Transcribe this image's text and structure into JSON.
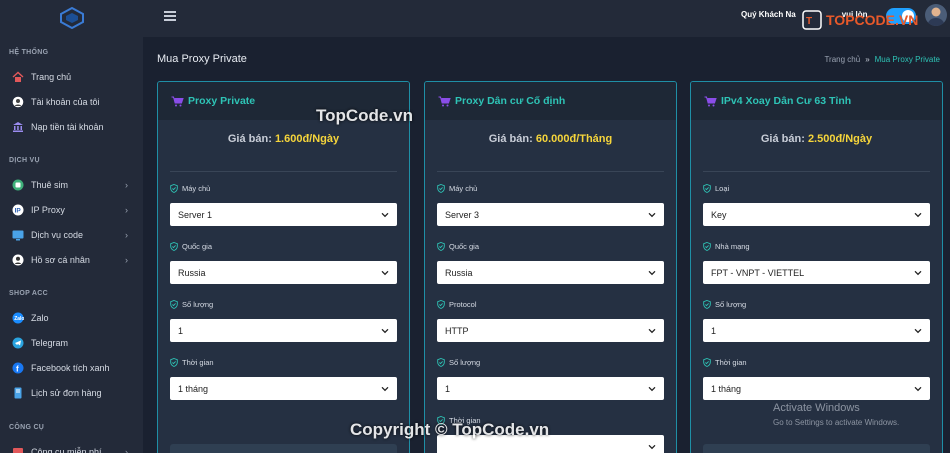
{
  "sidebar": {
    "sections": [
      {
        "title": "HỆ THỐNG",
        "items": [
          {
            "label": "Trang chủ",
            "icon": "home-icon",
            "chevron": false
          },
          {
            "label": "Tài khoản của tôi",
            "icon": "user-circle-icon",
            "chevron": false
          },
          {
            "label": "Nạp tiền tài khoản",
            "icon": "bank-icon",
            "chevron": false
          }
        ]
      },
      {
        "title": "DỊCH VỤ",
        "items": [
          {
            "label": "Thuê sim",
            "icon": "sim-icon",
            "chevron": true
          },
          {
            "label": "IP Proxy",
            "icon": "ip-icon",
            "chevron": true
          },
          {
            "label": "Dịch vụ code",
            "icon": "code-icon",
            "chevron": true
          },
          {
            "label": "Hồ sơ cá nhân",
            "icon": "profile-icon",
            "chevron": true
          }
        ]
      },
      {
        "title": "SHOP ACC",
        "items": [
          {
            "label": "Zalo",
            "icon": "zalo-icon",
            "chevron": false
          },
          {
            "label": "Telegram",
            "icon": "telegram-icon",
            "chevron": false
          },
          {
            "label": "Facebook tích xanh",
            "icon": "facebook-icon",
            "chevron": false
          },
          {
            "label": "Lịch sử đơn hàng",
            "icon": "history-icon",
            "chevron": false
          }
        ]
      },
      {
        "title": "CÔNG CỤ",
        "items": [
          {
            "label": "Công cụ miễn phí",
            "icon": "tool-icon",
            "chevron": true
          }
        ]
      }
    ]
  },
  "topbar": {
    "welcome": "Quý Khách Na",
    "welcome_tail": "vui lòn",
    "brand": "TOPCODE.VN"
  },
  "page": {
    "title": "Mua Proxy Private",
    "breadcrumb_home": "Trang chủ",
    "breadcrumb_sep": "»",
    "breadcrumb_current": "Mua Proxy Private"
  },
  "cards": [
    {
      "title": "Proxy Private",
      "price_label": "Giá bán:",
      "price_value": "1.600đ/Ngày",
      "fields": [
        {
          "label": "Máy chủ",
          "value": "Server 1"
        },
        {
          "label": "Quốc gia",
          "value": "Russia"
        },
        {
          "label": "Số lượng",
          "value": "1"
        },
        {
          "label": "Thời gian",
          "value": "1 tháng"
        }
      ]
    },
    {
      "title": "Proxy Dân cư Cố định",
      "price_label": "Giá bán:",
      "price_value": "60.000đ/Tháng",
      "fields": [
        {
          "label": "Máy chủ",
          "value": "Server 3"
        },
        {
          "label": "Quốc gia",
          "value": "Russia"
        },
        {
          "label": "Protocol",
          "value": "HTTP"
        },
        {
          "label": "Số lượng",
          "value": "1"
        },
        {
          "label": "Thời gian",
          "value": ""
        }
      ]
    },
    {
      "title": "IPv4 Xoay Dân Cư 63 Tỉnh",
      "price_label": "Giá bán:",
      "price_value": "2.500đ/Ngày",
      "fields": [
        {
          "label": "Loại",
          "value": "Key"
        },
        {
          "label": "Nhà mạng",
          "value": "FPT - VNPT - VIETTEL"
        },
        {
          "label": "Số lượng",
          "value": "1"
        },
        {
          "label": "Thời gian",
          "value": "1 tháng"
        }
      ]
    }
  ],
  "watermarks": {
    "topcode": "TopCode.vn",
    "copyright": "Copyright © TopCode.vn",
    "activate_title": "Activate Windows",
    "activate_sub": "Go to Settings to activate Windows."
  },
  "colors": {
    "accent": "#2ec4b6",
    "price": "#f6d53b",
    "card_border": "#1f8fa6",
    "sidebar_bg": "#232a39",
    "page_bg": "#1a2130"
  }
}
